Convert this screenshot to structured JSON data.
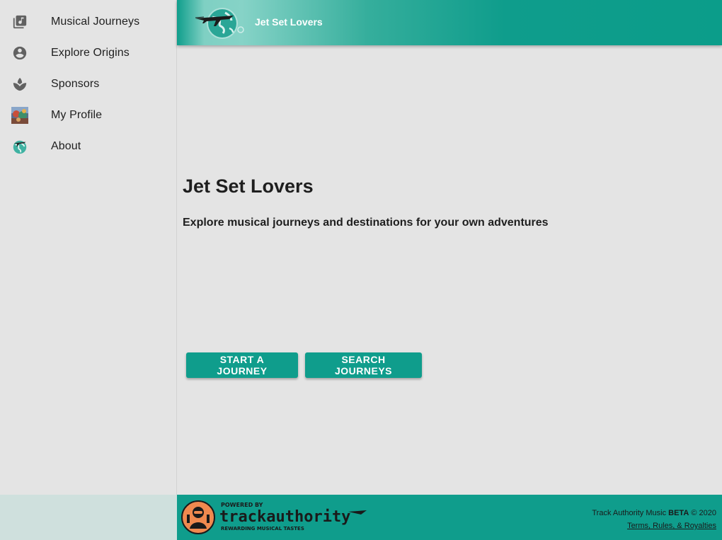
{
  "sidebar": {
    "items": [
      {
        "label": "Musical Journeys",
        "icon": "music-library-icon"
      },
      {
        "label": "Explore Origins",
        "icon": "account-circle-icon"
      },
      {
        "label": "Sponsors",
        "icon": "spa-icon"
      },
      {
        "label": "My Profile",
        "icon": "profile-avatar-icon"
      },
      {
        "label": "About",
        "icon": "globe-plane-icon"
      }
    ]
  },
  "header": {
    "title": "Jet Set Lovers",
    "logo": "jet-set-lovers-logo"
  },
  "main": {
    "title": "Jet Set Lovers",
    "subtitle": "Explore musical journeys and destinations for your own adventures",
    "start_button": "START A JOURNEY",
    "search_button": "SEARCH JOURNEYS"
  },
  "footer": {
    "powered_logo": "track-authority-powered-by-logo",
    "powered_by": "POWERED BY",
    "brand": "trackauthority",
    "tagline": "REWARDING MUSICAL TASTES",
    "copyright_prefix": "Track Authority Music ",
    "copyright_beta": "BETA",
    "copyright_suffix": " © 2020",
    "terms": "Terms, Rules, & Royalties"
  },
  "colors": {
    "accent": "#0f9d8c",
    "background": "#e4e4e4",
    "footer_logo_orange": "#f0894f"
  }
}
